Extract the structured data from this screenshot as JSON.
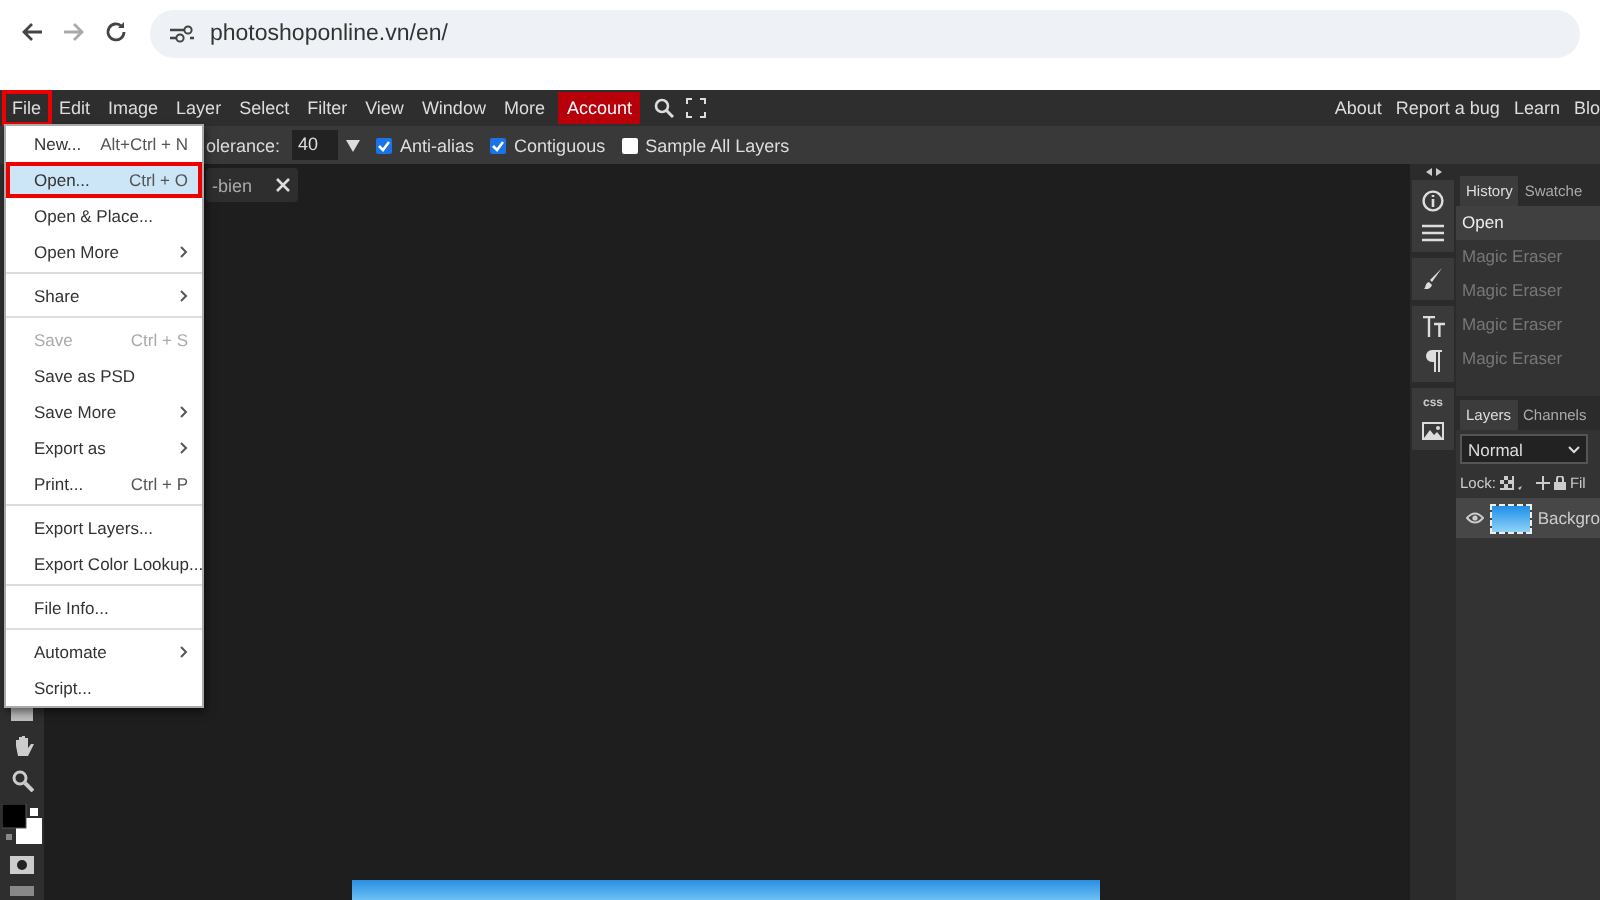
{
  "browser": {
    "url": "photoshoponline.vn/en/"
  },
  "menu_bar": {
    "items": [
      {
        "label": "File",
        "kind": "menu",
        "selected": true
      },
      {
        "label": "Edit",
        "kind": "menu",
        "selected": false
      },
      {
        "label": "Image",
        "kind": "menu",
        "selected": false
      },
      {
        "label": "Layer",
        "kind": "menu",
        "selected": false
      },
      {
        "label": "Select",
        "kind": "menu",
        "selected": false
      },
      {
        "label": "Filter",
        "kind": "menu",
        "selected": false
      },
      {
        "label": "View",
        "kind": "menu",
        "selected": false
      },
      {
        "label": "Window",
        "kind": "menu",
        "selected": false
      },
      {
        "label": "More",
        "kind": "menu",
        "selected": false
      },
      {
        "label": "Account",
        "kind": "account",
        "selected": false
      }
    ],
    "links": [
      "About",
      "Report a bug",
      "Learn",
      "Blo"
    ]
  },
  "options_bar": {
    "tolerance_label": "olerance:",
    "tolerance": "40",
    "checkboxes": [
      {
        "label": "Anti-alias",
        "checked": true
      },
      {
        "label": "Contiguous",
        "checked": true
      },
      {
        "label": "Sample All Layers",
        "checked": false
      }
    ]
  },
  "document_tabs": [
    {
      "label": "-bien"
    }
  ],
  "file_menu": {
    "sections": [
      {
        "items": [
          {
            "label": "New...",
            "shortcut": "Alt+Ctrl + N",
            "submenu": false,
            "disabled": false,
            "selected": false
          },
          {
            "label": "Open...",
            "shortcut": "Ctrl + O",
            "submenu": false,
            "disabled": false,
            "selected": true
          },
          {
            "label": "Open & Place...",
            "submenu": false,
            "disabled": false,
            "selected": false
          },
          {
            "label": "Open More",
            "submenu": true,
            "disabled": false,
            "selected": false
          }
        ]
      },
      {
        "items": [
          {
            "label": "Share",
            "submenu": true,
            "disabled": false,
            "selected": false
          }
        ]
      },
      {
        "items": [
          {
            "label": "Save",
            "shortcut": "Ctrl + S",
            "submenu": false,
            "disabled": true,
            "selected": false
          },
          {
            "label": "Save as PSD",
            "submenu": false,
            "disabled": false,
            "selected": false
          },
          {
            "label": "Save More",
            "submenu": true,
            "disabled": false,
            "selected": false
          },
          {
            "label": "Export as",
            "submenu": true,
            "disabled": false,
            "selected": false
          },
          {
            "label": "Print...",
            "shortcut": "Ctrl + P",
            "submenu": false,
            "disabled": false,
            "selected": false
          }
        ]
      },
      {
        "items": [
          {
            "label": "Export Layers...",
            "submenu": false,
            "disabled": false,
            "selected": false
          },
          {
            "label": "Export Color Lookup...",
            "submenu": false,
            "disabled": false,
            "selected": false
          }
        ]
      },
      {
        "items": [
          {
            "label": "File Info...",
            "submenu": false,
            "disabled": false,
            "selected": false
          }
        ]
      },
      {
        "items": [
          {
            "label": "Automate",
            "submenu": true,
            "disabled": false,
            "selected": false
          },
          {
            "label": "Script...",
            "submenu": false,
            "disabled": false,
            "selected": false
          }
        ]
      }
    ]
  },
  "tool_panel": {
    "css_label": "css"
  },
  "history": {
    "tabs": [
      {
        "label": "History",
        "selected": true
      },
      {
        "label": "Swatche",
        "selected": false
      }
    ],
    "items": [
      {
        "label": "Open",
        "selected": true,
        "undone": false
      },
      {
        "label": "Magic Eraser",
        "selected": false,
        "undone": true
      },
      {
        "label": "Magic Eraser",
        "selected": false,
        "undone": true
      },
      {
        "label": "Magic Eraser",
        "selected": false,
        "undone": true
      },
      {
        "label": "Magic Eraser",
        "selected": false,
        "undone": true
      }
    ]
  },
  "layers": {
    "tabs": [
      {
        "label": "Layers",
        "selected": true
      },
      {
        "label": "Channels",
        "selected": false
      }
    ],
    "blend_mode": "Normal",
    "lock_label": "Lock:",
    "fill_label": "Fil",
    "items": [
      {
        "name": "Backgro",
        "visible": true,
        "selected": true
      }
    ]
  }
}
